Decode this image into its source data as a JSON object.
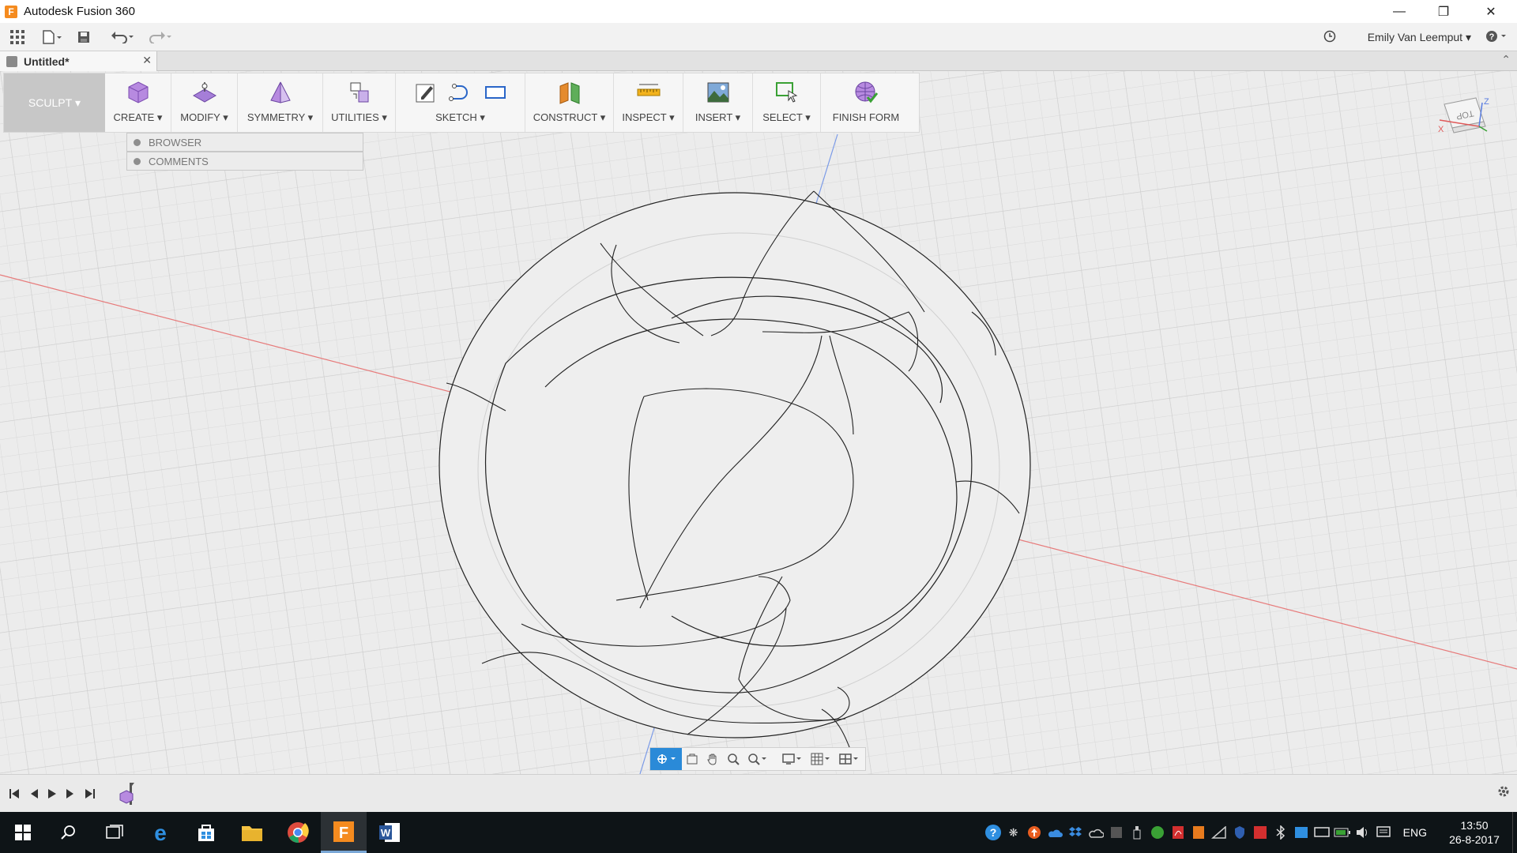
{
  "window": {
    "title": "Autodesk Fusion 360"
  },
  "app_toolbar": {
    "user_name": "Emily Van Leemput"
  },
  "doc_tab": {
    "name": "Untitled*"
  },
  "ribbon": {
    "workspace": "SCULPT",
    "groups": [
      {
        "label": "CREATE"
      },
      {
        "label": "MODIFY"
      },
      {
        "label": "SYMMETRY"
      },
      {
        "label": "UTILITIES"
      },
      {
        "label": "SKETCH"
      },
      {
        "label": "CONSTRUCT"
      },
      {
        "label": "INSPECT"
      },
      {
        "label": "INSERT"
      },
      {
        "label": "SELECT"
      },
      {
        "label": "FINISH FORM"
      }
    ]
  },
  "panels": {
    "browser": "BROWSER",
    "comments": "COMMENTS"
  },
  "viewcube": {
    "face": "TOP",
    "axis_z": "Z",
    "axis_x": "X"
  },
  "taskbar": {
    "language": "ENG",
    "time": "13:50",
    "date": "26-8-2017"
  },
  "colors": {
    "accent": "#0696d7",
    "workspace_bg": "#c7c7c7",
    "axis_red": "#e05050",
    "axis_blue": "#5080e0"
  },
  "icons": [
    "grid-menu-icon",
    "file-icon",
    "save-icon",
    "undo-icon",
    "redo-icon",
    "clock-icon",
    "help-icon"
  ]
}
